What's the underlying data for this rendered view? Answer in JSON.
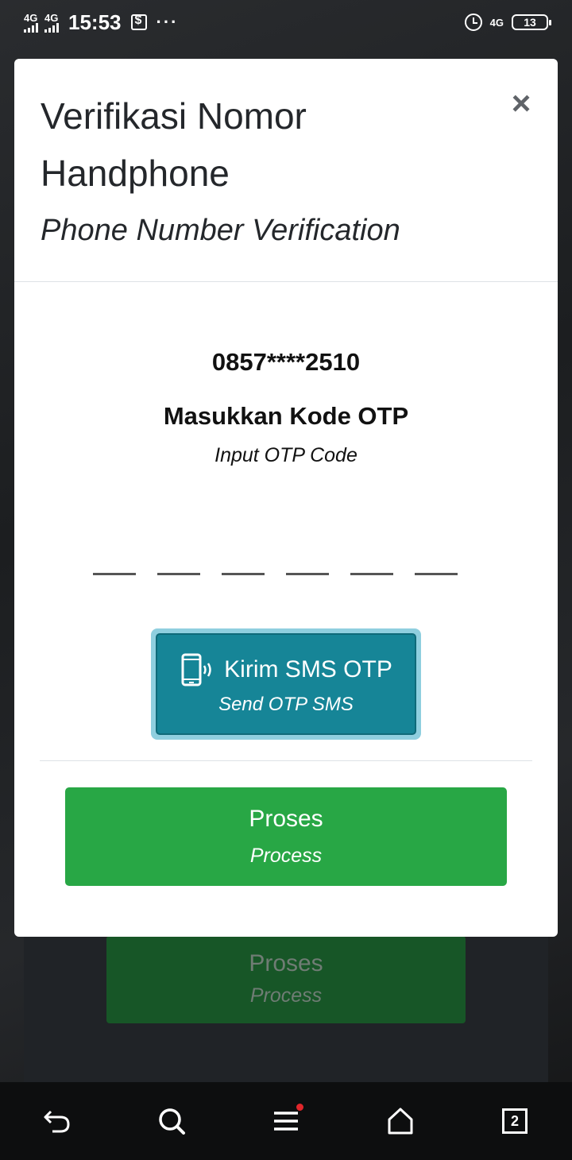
{
  "status_bar": {
    "network_left_1": "4G",
    "network_left_2": "4G",
    "time": "15:53",
    "more": "···",
    "network_right": "4G",
    "battery": "13"
  },
  "modal": {
    "title": "Verifikasi Nomor Handphone",
    "subtitle": "Phone Number Verification",
    "close_label": "×",
    "phone_number": "0857****2510",
    "otp_title": "Masukkan Kode OTP",
    "otp_subtitle": "Input OTP Code",
    "otp_digits": [
      "",
      "",
      "",
      "",
      "",
      ""
    ],
    "sms_button": {
      "label": "Kirim SMS OTP",
      "sublabel": "Send OTP SMS",
      "icon": "mobile-vibrate-icon"
    },
    "process_button": {
      "label": "Proses",
      "sublabel": "Process"
    }
  },
  "background": {
    "process_button": {
      "label": "Proses",
      "sublabel": "Process"
    }
  },
  "bottom_nav": {
    "tabs_count": "2",
    "items": [
      "back-icon",
      "search-icon",
      "menu-icon",
      "home-icon",
      "tabs-icon"
    ]
  },
  "colors": {
    "sms_button": "#168597",
    "process_button": "#28a745",
    "notification_dot": "#e0262b"
  }
}
